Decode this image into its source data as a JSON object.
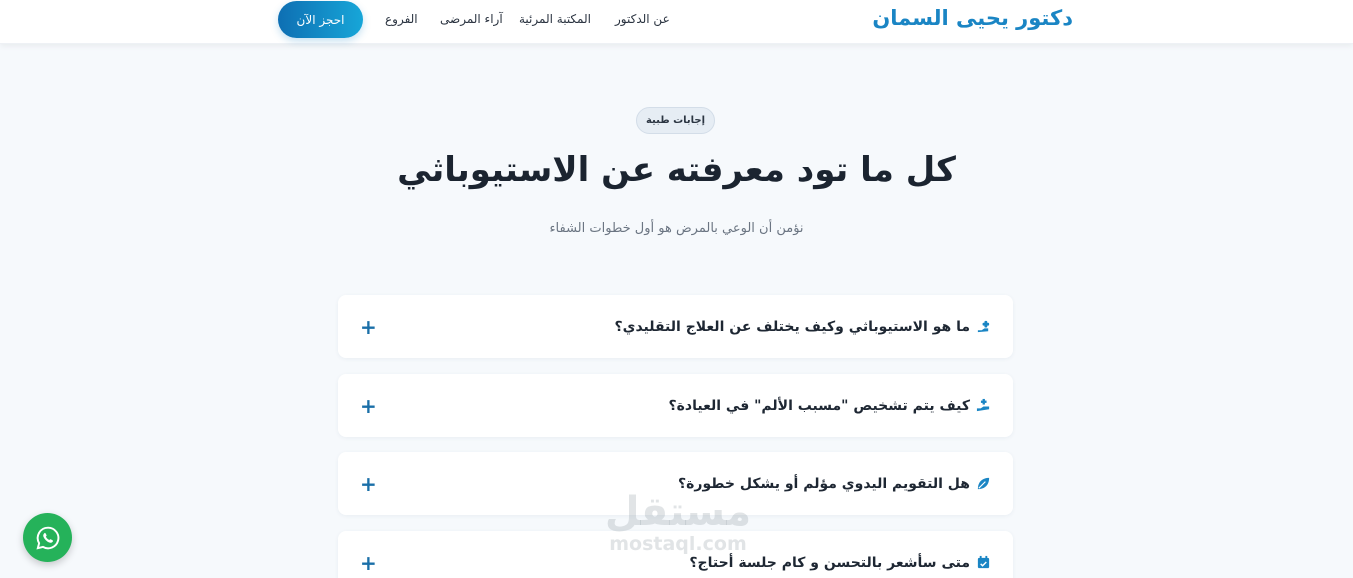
{
  "header": {
    "brand": "دكتور يحيى السمان",
    "nav": [
      {
        "label": "عن الدكتور"
      },
      {
        "label": "المكتبة المرئية"
      },
      {
        "label": "آراء المرضى"
      },
      {
        "label": "الفروع"
      }
    ],
    "cta_label": "احجز الآن"
  },
  "section": {
    "badge": "إجابات طبية",
    "title": "كل ما تود معرفته عن الاستيوباثي",
    "subtitle": "نؤمن أن الوعي بالمرض هو أول خطوات الشفاء"
  },
  "faq": [
    {
      "question": "ما هو الاستيوباثي وكيف يختلف عن العلاج التقليدي؟",
      "icon": "medical-hand-icon"
    },
    {
      "question": "كيف يتم تشخيص \"مسبب الألم\" في العيادة؟",
      "icon": "hand-holding-medical-icon"
    },
    {
      "question": "هل التقويم اليدوي مؤلم أو يشكل خطورة؟",
      "icon": "leaf-icon"
    },
    {
      "question": "متى سأشعر بالتحسن و كام جلسة أحتاج؟",
      "icon": "calendar-check-icon"
    }
  ],
  "faq_toggle_symbol": "+",
  "watermark": {
    "arabic": "مستقل",
    "latin": "mostaql.com"
  },
  "colors": {
    "brand": "#1a85c4",
    "cta_start": "#0e6fb3",
    "cta_end": "#17a6d8",
    "whatsapp": "#25b25a",
    "background": "#f6f9fc"
  }
}
